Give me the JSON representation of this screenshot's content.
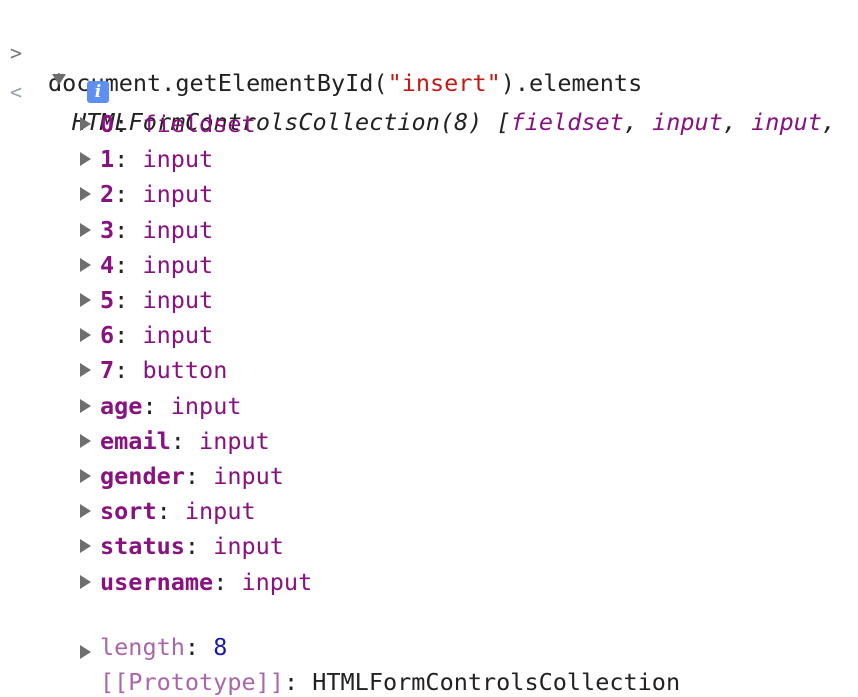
{
  "command": {
    "prompt": ">",
    "prefix": "document.getElementById(",
    "argument": "\"insert\"",
    "suffix": ").elements"
  },
  "result": {
    "arrow": "<",
    "type_name": "HTMLFormControlsCollection(8)",
    "preview_open": "[",
    "preview_items": [
      "fieldset",
      "input",
      "input"
    ],
    "preview_sep": ", ",
    "preview_trailing": ",",
    "info_icon": "i"
  },
  "entries": [
    {
      "key": "0",
      "value": "fieldset"
    },
    {
      "key": "1",
      "value": "input"
    },
    {
      "key": "2",
      "value": "input"
    },
    {
      "key": "3",
      "value": "input"
    },
    {
      "key": "4",
      "value": "input"
    },
    {
      "key": "5",
      "value": "input"
    },
    {
      "key": "6",
      "value": "input"
    },
    {
      "key": "7",
      "value": "button"
    },
    {
      "key": "age",
      "value": "input"
    },
    {
      "key": "email",
      "value": "input"
    },
    {
      "key": "gender",
      "value": "input"
    },
    {
      "key": "sort",
      "value": "input"
    },
    {
      "key": "status",
      "value": "input"
    },
    {
      "key": "username",
      "value": "input"
    }
  ],
  "length_entry": {
    "key": "length",
    "value": "8"
  },
  "prototype_entry": {
    "key": "[[Prototype]]",
    "value": "HTMLFormControlsCollection"
  },
  "colon": ": "
}
